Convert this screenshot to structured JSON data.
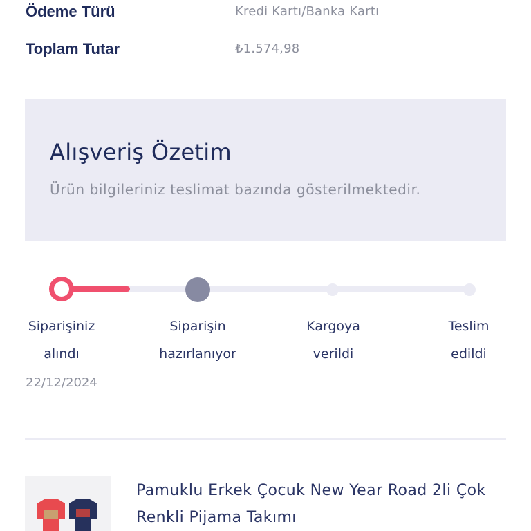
{
  "payment": {
    "type_label": "Ödeme Türü",
    "type_value": "Kredi Kartı/Banka Kartı",
    "total_label": "Toplam Tutar",
    "total_value": "₺1.574,98"
  },
  "summary": {
    "title": "Alışveriş Özetim",
    "subtitle": "Ürün bilgileriniz teslimat bazında gösterilmektedir."
  },
  "tracker": {
    "steps": [
      {
        "line1": "Siparişiniz",
        "line2": "alındı",
        "date": "22/12/2024",
        "status": "completed"
      },
      {
        "line1": "Siparişin",
        "line2": "hazırlanıyor",
        "status": "current"
      },
      {
        "line1": "Kargoya",
        "line2": "verildi",
        "status": "pending"
      },
      {
        "line1": "Teslim",
        "line2": "edildi",
        "status": "pending"
      }
    ]
  },
  "product": {
    "title": "Pamuklu Erkek Çocuk New Year Road 2li Çok Renkli Pijama Takımı",
    "thumbnail_alt": "pajama-set-thumbnail"
  },
  "colors": {
    "brand_navy": "#1f2b5b",
    "accent_pink": "#f0506e",
    "muted_gray": "#8c8f9c",
    "panel_bg": "#ebebf4",
    "step_active": "#878aa2"
  },
  "icons": {
    "step_completed": "progress-ring-icon",
    "step_current": "progress-dot-icon",
    "step_pending": "progress-dot-small-icon"
  }
}
